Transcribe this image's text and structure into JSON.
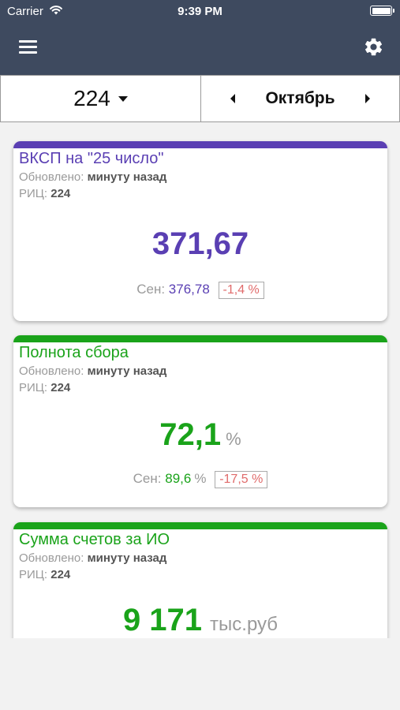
{
  "status_bar": {
    "carrier": "Carrier",
    "time": "9:39 PM"
  },
  "header": {
    "menu_icon": "hamburger-menu-icon",
    "settings_icon": "gear-icon"
  },
  "selector": {
    "rc_value": "224",
    "month": "Октябрь"
  },
  "colors": {
    "header_bg": "#3e4a5f",
    "purple": "#5a3fb3",
    "green": "#1aa31a",
    "delta_red": "#e06b6b"
  },
  "cards": [
    {
      "title": "ВКСП на \"25 число\"",
      "updated_label": "Обновлено:",
      "updated_value": "минуту назад",
      "rc_label": "РИЦ:",
      "rc_value": "224",
      "value": "371,67",
      "unit": "",
      "prev_label": "Сен:",
      "prev_value": "376,78",
      "prev_unit": "",
      "delta": "-1,4 %",
      "accent": "#5a3fb3"
    },
    {
      "title": "Полнота сбора",
      "updated_label": "Обновлено:",
      "updated_value": "минуту назад",
      "rc_label": "РИЦ:",
      "rc_value": "224",
      "value": "72,1",
      "unit": "%",
      "prev_label": "Сен:",
      "prev_value": "89,6",
      "prev_unit": "%",
      "delta": "-17,5 %",
      "accent": "#1aa31a"
    },
    {
      "title": "Сумма счетов за ИО",
      "updated_label": "Обновлено:",
      "updated_value": "минуту назад",
      "rc_label": "РИЦ:",
      "rc_value": "224",
      "value": "9 171",
      "unit": "тыс.руб",
      "accent": "#1aa31a"
    }
  ]
}
